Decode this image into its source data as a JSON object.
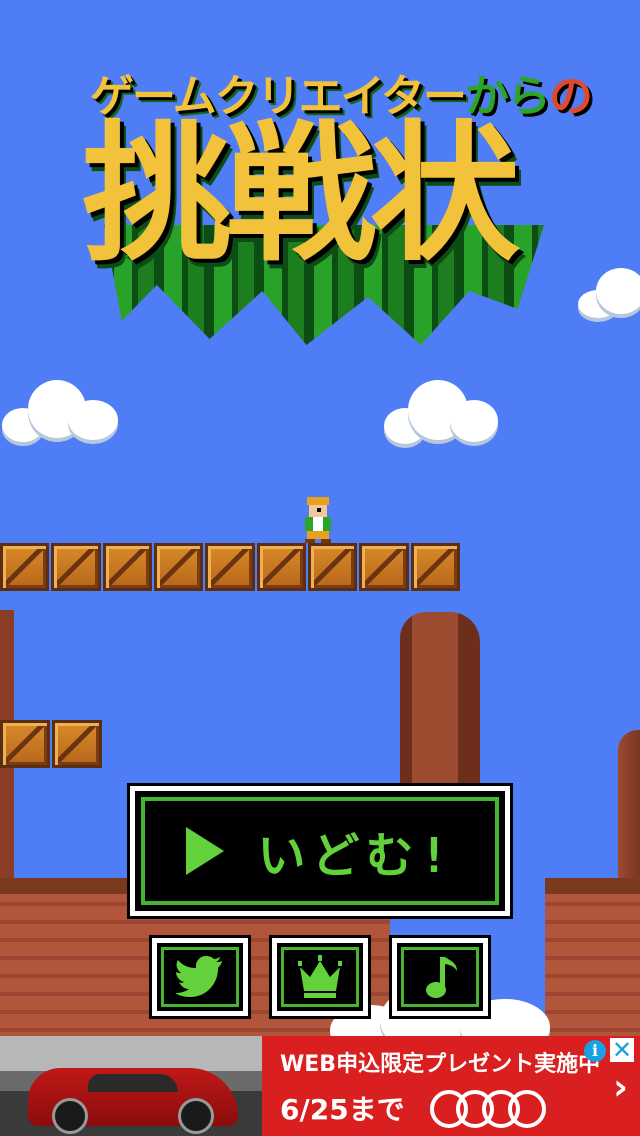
{
  "title": {
    "subtitle_a": "ゲームクリエイター",
    "subtitle_b": "から",
    "subtitle_c": "の",
    "main": "挑戦状"
  },
  "menu": {
    "start_label": "いどむ!",
    "start_icon": "play-triangle-icon",
    "buttons": [
      {
        "icon": "twitter-bird-icon"
      },
      {
        "icon": "crown-icon"
      },
      {
        "icon": "music-note-icon"
      }
    ]
  },
  "ad": {
    "line1": "WEB申込限定プレゼント実施中",
    "line2": "6/25まで",
    "info_glyph": "i",
    "close_glyph": "✕",
    "chevron_glyph": "›",
    "brand_icon": "four-rings-logo"
  },
  "colors": {
    "sky": "#4f7df6",
    "title_yellow": "#f2c23a",
    "title_green": "#2aa528",
    "ui_green": "#62d13c",
    "ad_red": "#d91f1f"
  }
}
